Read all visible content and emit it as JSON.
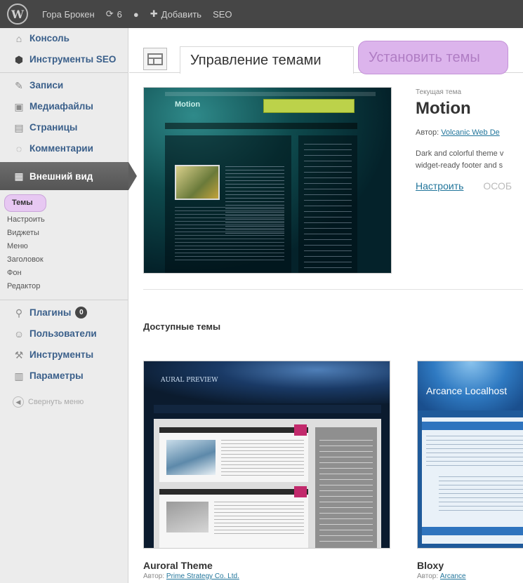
{
  "admin_bar": {
    "site_name": "Гора Брокен",
    "updates_count": "6",
    "add_label": "Добавить",
    "seo_label": "SEO"
  },
  "sidebar": {
    "items": [
      {
        "label": "Консоль",
        "icon": "house-icon"
      },
      {
        "label": "Инструменты SEO",
        "icon": "seo-shield-icon"
      },
      {
        "label": "Записи",
        "icon": "pin-icon"
      },
      {
        "label": "Медиафайлы",
        "icon": "media-icon"
      },
      {
        "label": "Страницы",
        "icon": "page-icon"
      },
      {
        "label": "Комментарии",
        "icon": "comment-icon"
      },
      {
        "label": "Внешний вид",
        "icon": "appearance-icon"
      }
    ],
    "appearance_submenu": [
      "Темы",
      "Настроить",
      "Виджеты",
      "Меню",
      "Заголовок",
      "Фон",
      "Редактор"
    ],
    "items_after": [
      {
        "label": "Плагины",
        "icon": "plug-icon",
        "badge": "0"
      },
      {
        "label": "Пользователи",
        "icon": "users-icon"
      },
      {
        "label": "Инструменты",
        "icon": "tools-icon"
      },
      {
        "label": "Параметры",
        "icon": "settings-icon"
      }
    ],
    "collapse_label": "Свернуть меню"
  },
  "tabs": {
    "manage": "Управление темами",
    "install": "Установить темы"
  },
  "current_theme": {
    "label": "Текущая тема",
    "name": "Motion",
    "author_prefix": "Автор:",
    "author": "Volcanic Web De",
    "description_line1": "Dark and colorful theme v",
    "description_line2": "widget-ready footer and s",
    "customize_label": "Настроить",
    "options_label": "ОСОБ",
    "preview_site_title": "Motion"
  },
  "available_title": "Доступные темы",
  "themes": [
    {
      "name": "Auroral Theme",
      "author_prefix": "Автор:",
      "author": "Prime Strategy Co. Ltd.",
      "preview_title": "AURAL PREVIEW"
    },
    {
      "name": "Bloxy",
      "author_prefix": "Автор:",
      "author": "Arcance",
      "preview_title": "Arcance Localhost"
    }
  ],
  "colors": {
    "admin_bar": "#464646",
    "sidebar_bg": "#ececec",
    "link": "#21759b",
    "highlight": "#dcb4ec"
  }
}
